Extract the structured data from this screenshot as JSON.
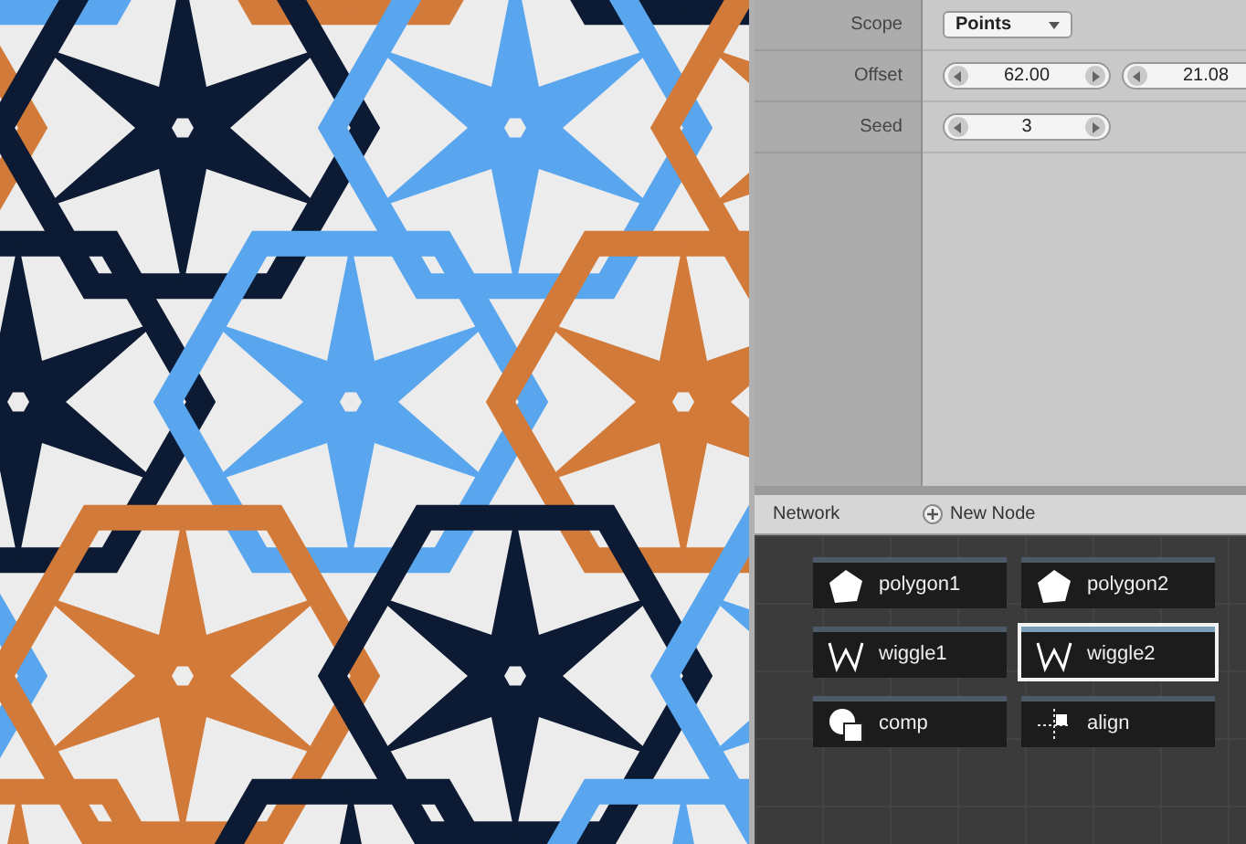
{
  "parameters": [
    {
      "label": "Scope",
      "kind": "menu",
      "value": "Points"
    },
    {
      "label": "Offset",
      "kind": "number",
      "values": [
        "62.00",
        "21.08"
      ]
    },
    {
      "label": "Seed",
      "kind": "number",
      "values": [
        "3"
      ]
    }
  ],
  "network": {
    "title": "Network",
    "new_node": "New Node",
    "nodes": [
      {
        "name": "polygon1",
        "kind": "polygon",
        "selected": false
      },
      {
        "name": "polygon2",
        "kind": "polygon",
        "selected": false
      },
      {
        "name": "wiggle1",
        "kind": "wiggle",
        "selected": false
      },
      {
        "name": "wiggle2",
        "kind": "wiggle",
        "selected": true
      },
      {
        "name": "comp",
        "kind": "compound",
        "selected": false
      },
      {
        "name": "align",
        "kind": "align",
        "selected": false
      }
    ]
  }
}
